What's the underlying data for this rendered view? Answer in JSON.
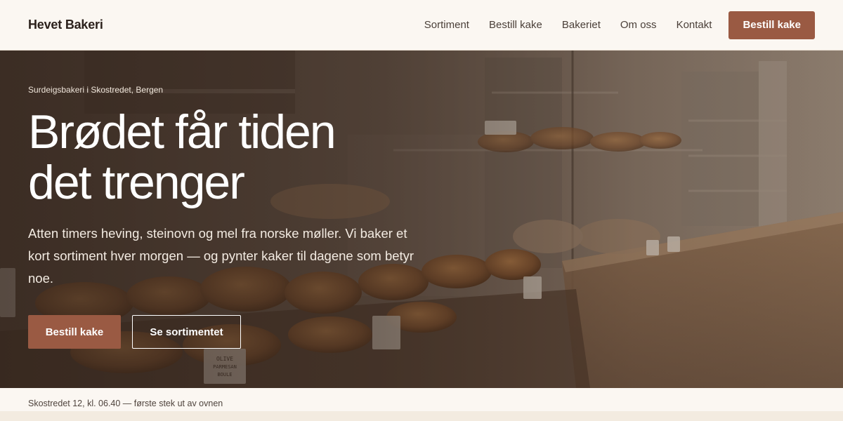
{
  "header": {
    "logo": "Hevet Bakeri",
    "nav": [
      "Sortiment",
      "Bestill kake",
      "Bakeriet",
      "Om oss",
      "Kontakt"
    ],
    "cta": "Bestill kake"
  },
  "hero": {
    "eyebrow": "Surdeigsbakeri i Skostredet, Bergen",
    "title_line1": "Brødet får tiden",
    "title_line2": "det trenger",
    "lead": "Atten timers heving, steinovn og mel fra norske møller. Vi baker et kort sortiment hver morgen — og pynter kaker til dagene som betyr noe.",
    "primary_button": "Bestill kake",
    "secondary_button": "Se sortimentet",
    "sign_text": "OLIVE PARMESAN BOULE"
  },
  "info_bar": {
    "text": "Skostredet 12, kl. 06.40 — første stek ut av ovnen"
  },
  "colors": {
    "accent": "#9a5a43",
    "header_bg": "#fbf7f2",
    "text_dark": "#2b211c"
  }
}
